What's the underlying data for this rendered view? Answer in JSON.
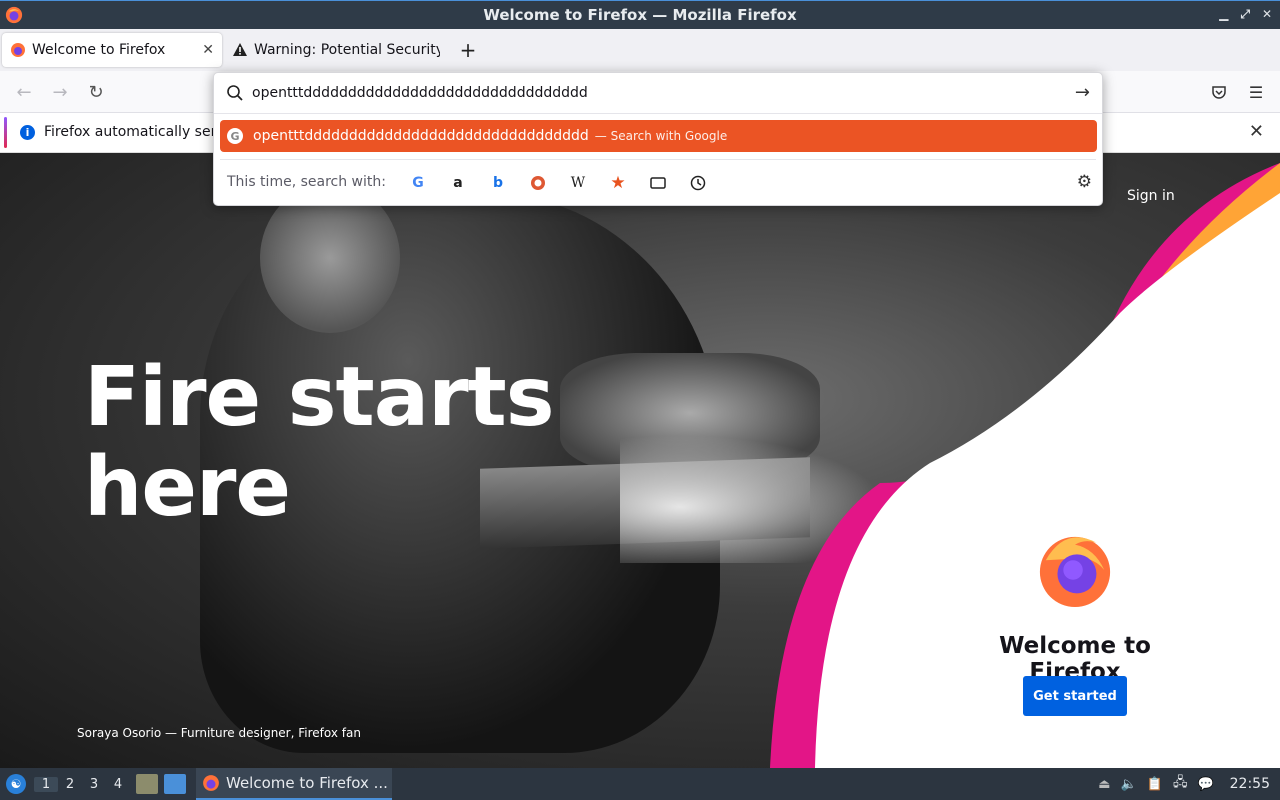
{
  "window": {
    "title": "Welcome to Firefox — Mozilla Firefox"
  },
  "tabs": [
    {
      "title": "Welcome to Firefox",
      "icon": "firefox-icon",
      "active": true
    },
    {
      "title": "Warning: Potential Security Risk Ahead",
      "icon": "warning-icon",
      "active": false
    }
  ],
  "urlbar": {
    "value": "opentttdddddddddddddddddddddddddddddddd",
    "result_text": "opentttdddddddddddddddddddddddddddddddd",
    "result_action": "— Search with Google",
    "oneoff_label": "This time, search with:",
    "accent_color": "#eb5424"
  },
  "notification": {
    "text": "Firefox automatically sends some data to Mozilla so that we can improve your experience."
  },
  "page": {
    "hero_line1": "Fire starts",
    "hero_line2": "here",
    "caption": "Soraya Osorio — Furniture designer, Firefox fan",
    "sign_in": "Sign in",
    "welcome_title": "Welcome to Firefox",
    "get_started": "Get started",
    "button_color": "#0061e0"
  },
  "taskbar": {
    "workspaces": [
      "1",
      "2",
      "3",
      "4"
    ],
    "active_workspace": "1",
    "window_title": "Welcome to Firefox ...",
    "clock": "22:55"
  }
}
